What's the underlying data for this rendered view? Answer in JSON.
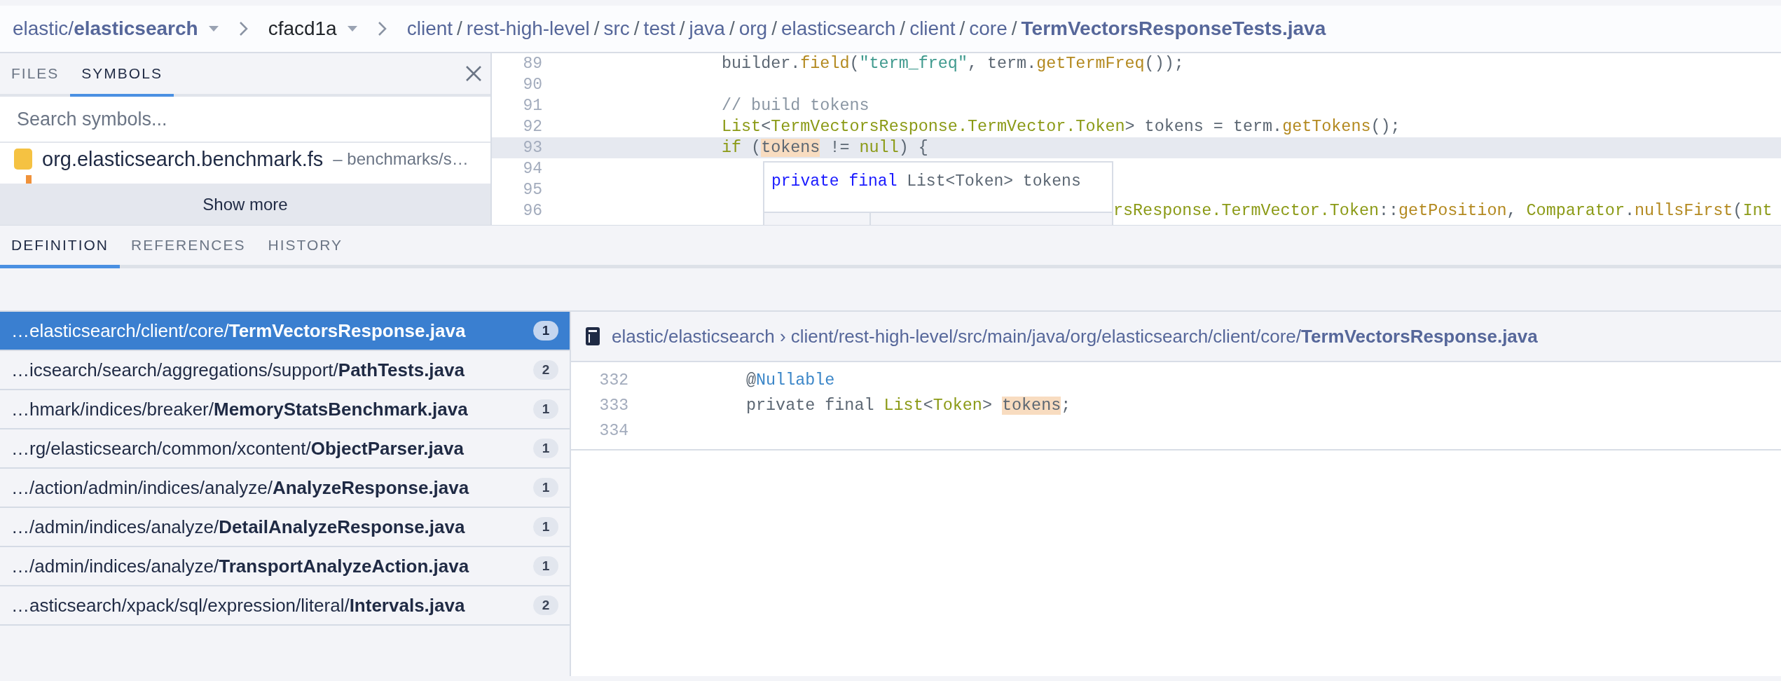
{
  "breadcrumb": {
    "repo": "elastic/**elasticsearch**",
    "revision": "cfacd1a",
    "path": [
      {
        "name": "client",
        "separator": "/"
      },
      {
        "name": "rest-high-level",
        "separator": "/"
      },
      {
        "name": "src",
        "separator": "/"
      },
      {
        "name": "test",
        "separator": "/"
      },
      {
        "name": "java",
        "separator": "/"
      },
      {
        "name": "org",
        "separator": "/"
      },
      {
        "name": "elasticsearch",
        "separator": "/"
      },
      {
        "name": "client",
        "separator": "/"
      },
      {
        "name": "core",
        "separator": "/"
      }
    ],
    "file": "TermVectorsResponseTests.java"
  },
  "sidebar": {
    "tabs": [
      {
        "label": "FILES",
        "selected": false
      },
      {
        "label": "SYMBOLS",
        "selected": true
      }
    ],
    "search": {
      "placeholder": "Search symbols..."
    },
    "symbols": [
      {
        "name": "org.elasticsearch.benchmark.fs",
        "location": "– benchmarks/s…",
        "color": "#f5c242"
      },
      {
        "color": "#f0923a"
      }
    ],
    "show_more": "Show more"
  },
  "editor": {
    "lines": [
      {
        "number": "89",
        "selected": false,
        "segments": [
          {
            "kind": "plain",
            "text": "builder."
          },
          {
            "kind": "method",
            "text": "field"
          },
          {
            "kind": "plain",
            "text": "("
          },
          {
            "kind": "string",
            "text": "\"term_freq\""
          },
          {
            "kind": "plain",
            "text": ", term."
          },
          {
            "kind": "method",
            "text": "getTermFreq"
          },
          {
            "kind": "plain",
            "text": "());"
          }
        ]
      },
      {
        "number": "90",
        "selected": false
      },
      {
        "number": "91",
        "selected": false,
        "segments": [
          {
            "kind": "comment",
            "text": "// build tokens"
          }
        ]
      },
      {
        "number": "92",
        "selected": false,
        "segments": [
          {
            "kind": "type",
            "text": "List"
          },
          {
            "kind": "plain",
            "text": "<"
          },
          {
            "kind": "type",
            "text": "TermVectorsResponse.TermVector.Token"
          },
          {
            "kind": "plain",
            "text": "> tokens = term."
          },
          {
            "kind": "method",
            "text": "getTokens"
          },
          {
            "kind": "plain",
            "text": "();"
          }
        ]
      },
      {
        "number": "93",
        "selected": true,
        "segments": [
          {
            "kind": "type",
            "text": "if"
          },
          {
            "kind": "plain",
            "text": " ("
          },
          {
            "kind": "highlight",
            "text": "tokens"
          },
          {
            "kind": "plain",
            "text": " != "
          },
          {
            "kind": "type",
            "text": "null"
          },
          {
            "kind": "plain",
            "text": ") {"
          }
        ]
      },
      {
        "number": "94",
        "selected": false
      },
      {
        "number": "95",
        "selected": false
      },
      {
        "number": "96",
        "selected": false,
        "segments": [
          {
            "kind": "type",
            "text": "rsResponse.TermVector.Token"
          },
          {
            "kind": "plain",
            "text": "::"
          },
          {
            "kind": "method",
            "text": "getPosition"
          },
          {
            "kind": "plain",
            "text": ", "
          },
          {
            "kind": "type",
            "text": "Comparator"
          },
          {
            "kind": "plain",
            "text": "."
          },
          {
            "kind": "method",
            "text": "nullsFirst"
          },
          {
            "kind": "plain",
            "text": "("
          },
          {
            "kind": "type",
            "text": "Int"
          }
        ]
      }
    ],
    "tooltip": {
      "segments": [
        {
          "kind": "keyword",
          "text": "private final"
        },
        {
          "kind": "plain",
          "text": " List<Token> tokens"
        }
      ]
    }
  },
  "panel_tabs": [
    {
      "label": "DEFINITION",
      "selected": true
    },
    {
      "label": "REFERENCES",
      "selected": false
    },
    {
      "label": "HISTORY",
      "selected": false
    }
  ],
  "results": [
    {
      "path": "…elasticsearch/client/core/**TermVectorsResponse.java**",
      "count": "1",
      "selected": true
    },
    {
      "path": "…icsearch/search/aggregations/support/**PathTests.java**",
      "count": "2",
      "selected": false
    },
    {
      "path": "…hmark/indices/breaker/**MemoryStatsBenchmark.java**",
      "count": "1",
      "selected": false
    },
    {
      "path": "…rg/elasticsearch/common/xcontent/**ObjectParser.java**",
      "count": "1",
      "selected": false
    },
    {
      "path": "…/action/admin/indices/analyze/**AnalyzeResponse.java**",
      "count": "1",
      "selected": false
    },
    {
      "path": "…/admin/indices/analyze/**DetailAnalyzeResponse.java**",
      "count": "1",
      "selected": false
    },
    {
      "path": "…/admin/indices/analyze/**TransportAnalyzeAction.java**",
      "count": "1",
      "selected": false
    },
    {
      "path": "…asticsearch/xpack/sql/expression/literal/**Intervals.java**",
      "count": "2",
      "selected": false
    }
  ],
  "definition": {
    "header": "elastic/elasticsearch › client/rest-high-level/src/main/java/org/elasticsearch/client/core/**TermVectorsResponse.java**",
    "lines": [
      {
        "number": "332",
        "selected": false,
        "segments": [
          {
            "kind": "plain",
            "text": "@"
          },
          {
            "kind": "annotation",
            "text": "Nullable"
          }
        ]
      },
      {
        "number": "333",
        "selected": false,
        "segments": [
          {
            "kind": "plain",
            "text": "private final "
          },
          {
            "kind": "type",
            "text": "List"
          },
          {
            "kind": "plain",
            "text": "<"
          },
          {
            "kind": "type",
            "text": "Token"
          },
          {
            "kind": "plain",
            "text": "> "
          },
          {
            "kind": "highlight",
            "text": "tokens"
          },
          {
            "kind": "plain",
            "text": ";"
          }
        ]
      },
      {
        "number": "334",
        "selected": false
      }
    ]
  }
}
